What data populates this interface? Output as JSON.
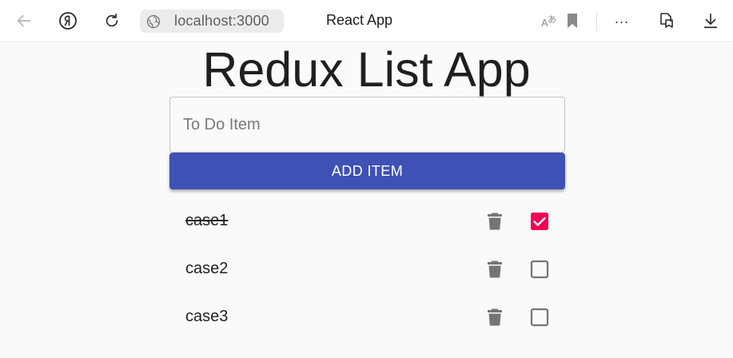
{
  "browser": {
    "url": "localhost:3000",
    "tab_title": "React App",
    "more_label": "...",
    "icons": [
      "back-icon",
      "yandex-icon",
      "reload-icon",
      "globe-icon",
      "translate-icon",
      "bookmark-icon",
      "more-icon",
      "collections-icon",
      "download-icon"
    ]
  },
  "app": {
    "title": "Redux List App",
    "input": {
      "placeholder": "To Do Item",
      "value": ""
    },
    "add_button_label": "ADD ITEM",
    "accent_color": "#3f51b5",
    "checked_color": "#f50057",
    "items": [
      {
        "text": "case1",
        "done": true
      },
      {
        "text": "case2",
        "done": false
      },
      {
        "text": "case3",
        "done": false
      }
    ]
  }
}
